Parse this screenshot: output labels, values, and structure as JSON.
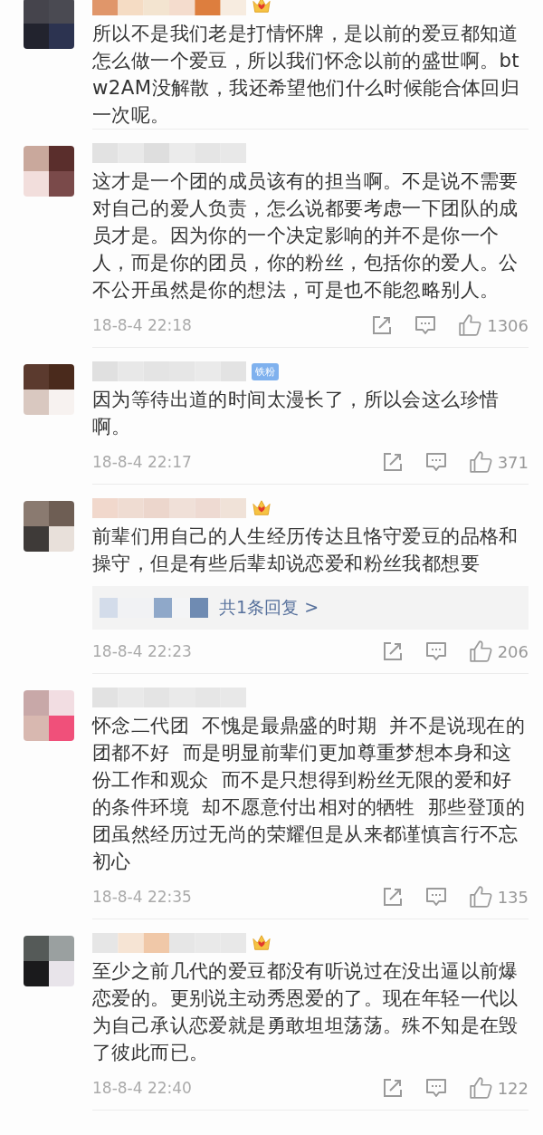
{
  "comments": [
    {
      "badge": {
        "kind": "crown"
      },
      "text": "所以不是我们老是打情怀牌，是以前的爱豆都知道怎么做一个爱豆，所以我们怀念以前的盛世啊。btw2AM没解散，我还希望他们什么时候能合体回归一次呢。"
    },
    {
      "text": "这才是一个团的成员该有的担当啊。不是说不需要对自己的爱人负责，怎么说都要考虑一下团队的成员才是。因为你的一个决定影响的并不是你一个人，而是你的团员，你的粉丝，包括你的爱人。公不公开虽然是你的想法，可是也不能忽略别人。",
      "time": "18-8-4 22:18",
      "likes": "1306"
    },
    {
      "badge": {
        "kind": "fan",
        "label": "铁粉"
      },
      "text": "因为等待出道的时间太漫长了，所以会这么珍惜啊。",
      "time": "18-8-4 22:17",
      "likes": "371"
    },
    {
      "badge": {
        "kind": "crown"
      },
      "text": "前辈们用自己的人生经历传达且恪守爱豆的品格和操守，但是有些后辈却说恋爱和粉丝我都想要",
      "reply": {
        "label": "共1条回复 >"
      },
      "time": "18-8-4 22:23",
      "likes": "206"
    },
    {
      "text": "怀念二代团  不愧是最鼎盛的时期  并不是说现在的团都不好  而是明显前辈们更加尊重梦想本身和这份工作和观众  而不是只想得到粉丝无限的爱和好的条件环境  却不愿意付出相对的牺牲  那些登顶的团虽然经历过无尚的荣耀但是从来都谨慎言行不忘初心",
      "time": "18-8-4 22:35",
      "likes": "135"
    },
    {
      "badge": {
        "kind": "crown"
      },
      "text": "至少之前几代的爱豆都没有听说过在没出逼以前爆恋爱的。更别说主动秀恩爱的了。现在年轻一代以为自己承认恋爱就是勇敢坦坦荡荡。殊不知是在毁了彼此而已。",
      "time": "18-8-4 22:40",
      "likes": "122"
    }
  ]
}
